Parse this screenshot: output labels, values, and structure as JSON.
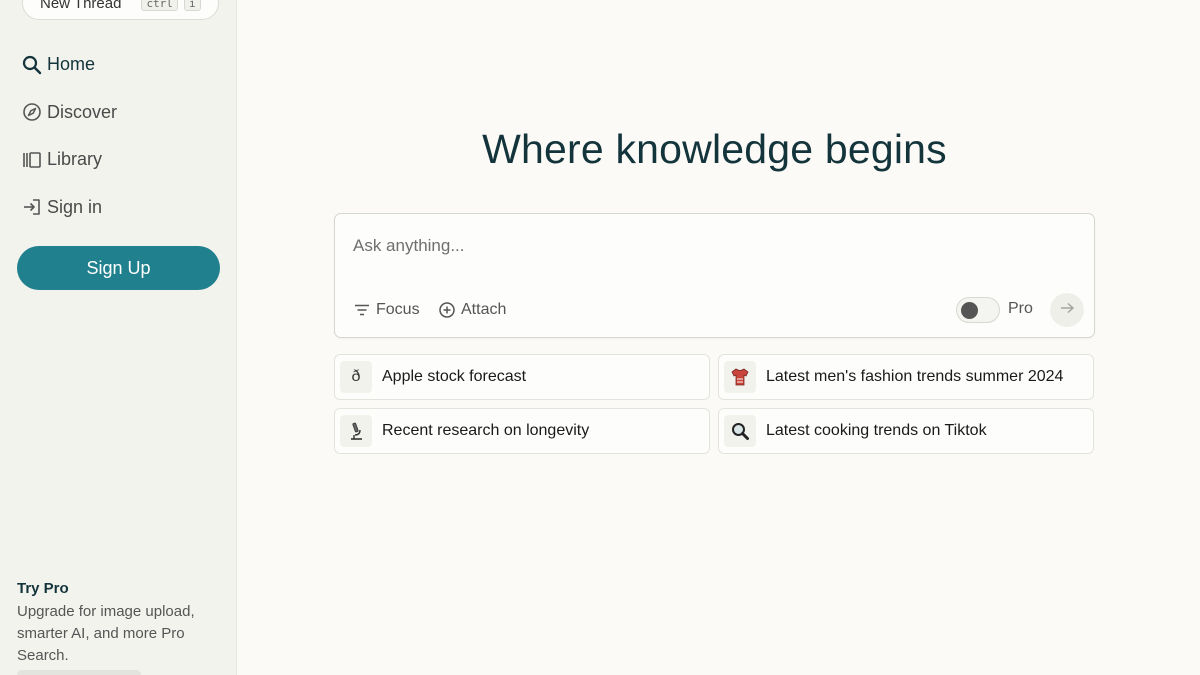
{
  "sidebar": {
    "new_thread": {
      "label": "New Thread",
      "shortcut": [
        "ctrl",
        "i"
      ]
    },
    "nav": [
      {
        "label": "Home",
        "icon": "search-icon",
        "active": true
      },
      {
        "label": "Discover",
        "icon": "compass-icon",
        "active": false
      },
      {
        "label": "Library",
        "icon": "library-icon",
        "active": false
      },
      {
        "label": "Sign in",
        "icon": "sign-in-icon",
        "active": false
      }
    ],
    "signup_label": "Sign Up",
    "try_pro": {
      "title": "Try Pro",
      "description": "Upgrade for image upload, smarter AI, and more Pro Search."
    }
  },
  "main": {
    "headline": "Where knowledge begins",
    "search": {
      "placeholder": "Ask anything...",
      "value": "",
      "focus_label": "Focus",
      "attach_label": "Attach",
      "pro_label": "Pro",
      "pro_enabled": false
    },
    "suggestions": [
      {
        "emoji": "ð",
        "label": "Apple stock forecast"
      },
      {
        "emoji": "shirt-icon",
        "label": "Latest men's fashion trends summer 2024"
      },
      {
        "emoji": "microscope-icon",
        "label": "Recent research on longevity"
      },
      {
        "emoji": "magnifier-icon",
        "label": "Latest cooking trends on Tiktok"
      }
    ]
  },
  "colors": {
    "accent": "#20808d",
    "background": "#fbfaf7",
    "sidebar_bg": "#f3f3ee",
    "text_dark": "#13343b"
  }
}
